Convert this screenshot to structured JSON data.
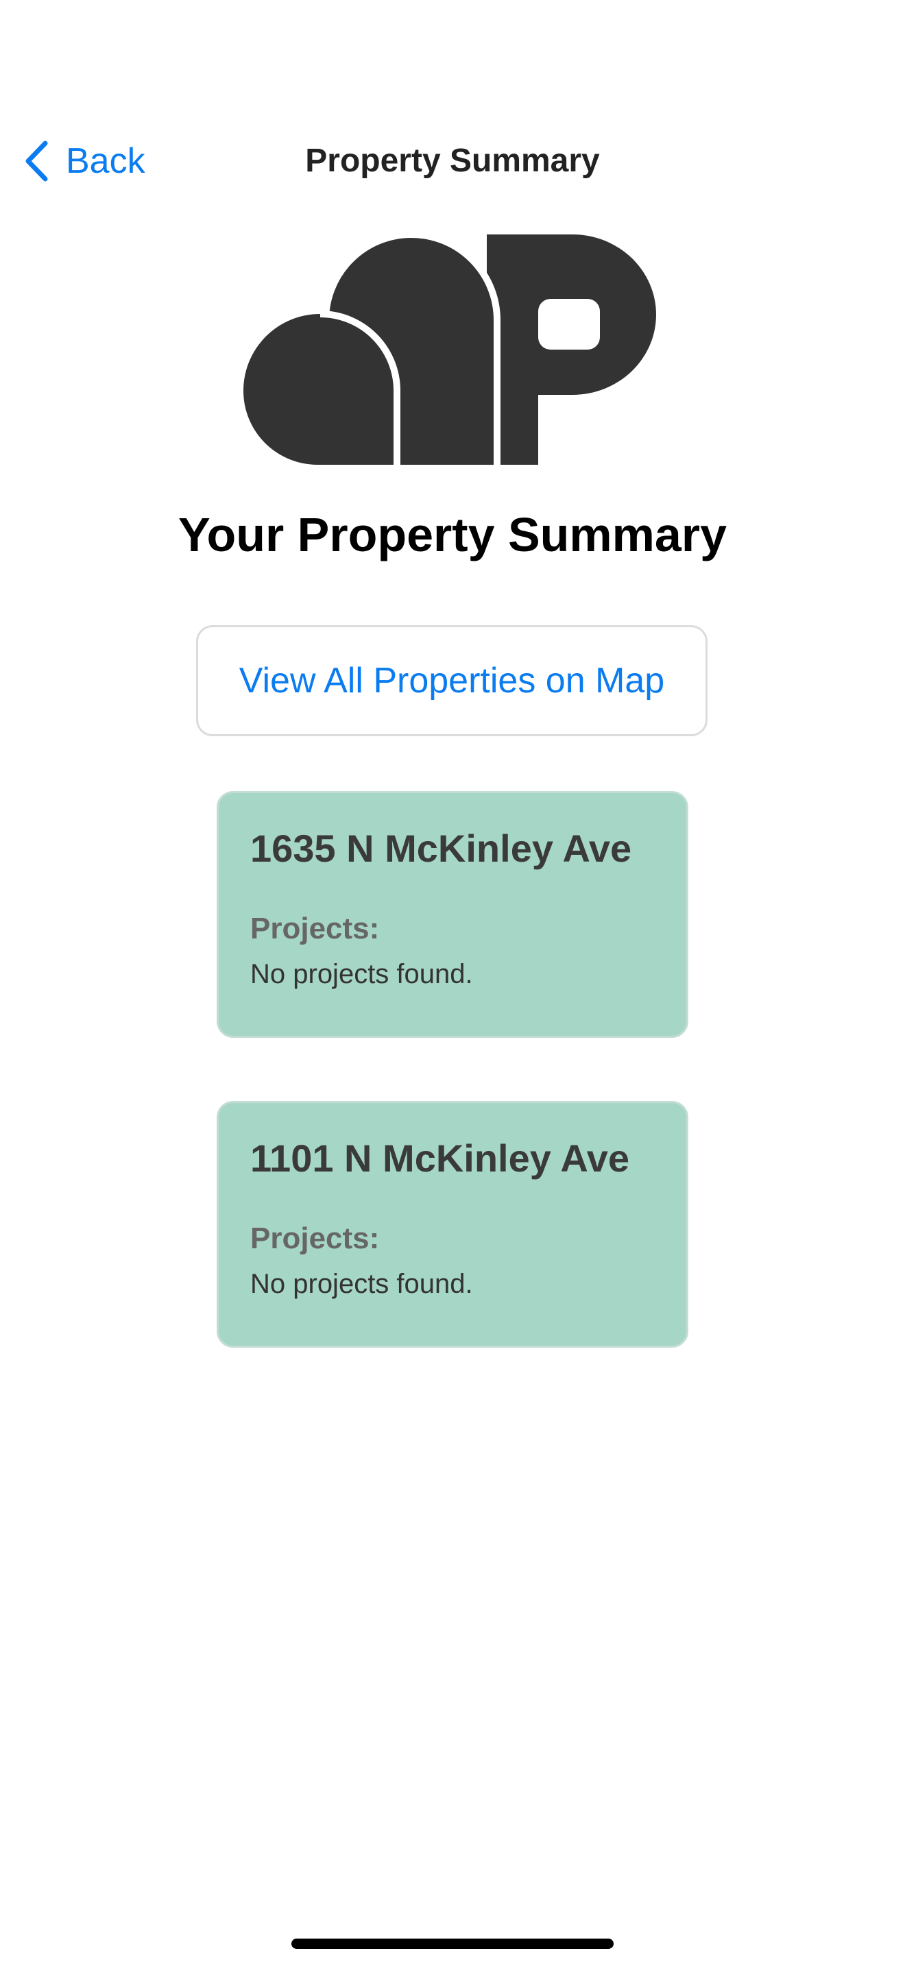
{
  "nav": {
    "back_label": "Back",
    "title": "Property Summary"
  },
  "page": {
    "heading": "Your Property Summary"
  },
  "map_button": {
    "label": "View All Properties on Map"
  },
  "properties": [
    {
      "address": "1635 N McKinley Ave",
      "projects_label": "Projects:",
      "projects_value": "No projects found."
    },
    {
      "address": "1101 N McKinley Ave",
      "projects_label": "Projects:",
      "projects_value": "No projects found."
    }
  ],
  "icons": {
    "back": "chevron-left-icon",
    "logo": "app-logo"
  },
  "colors": {
    "accent": "#0a7cf0",
    "card_background": "#a6d6c6",
    "logo": "#333333"
  }
}
